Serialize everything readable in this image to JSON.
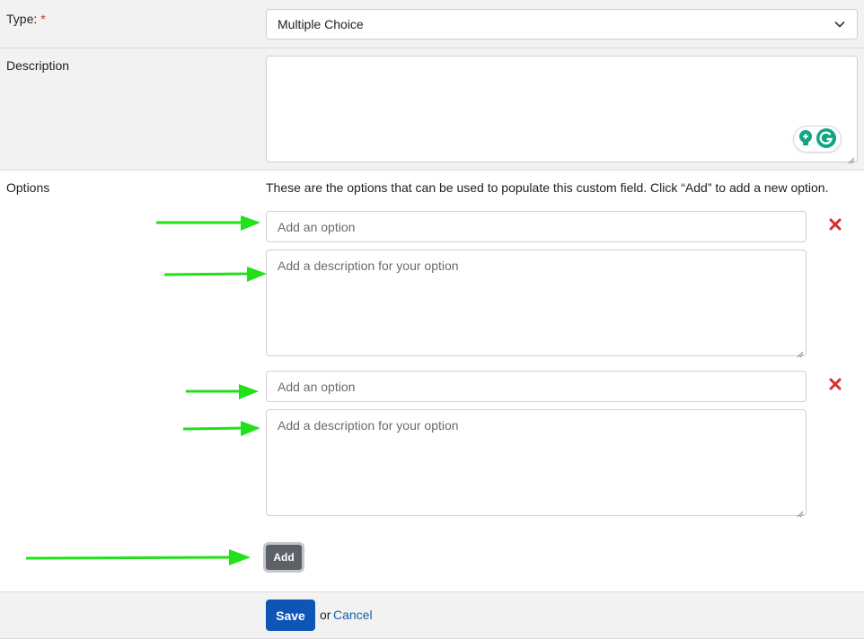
{
  "type_field": {
    "label": "Type:",
    "required_marker": "*",
    "selected_value": "Multiple Choice"
  },
  "description_field": {
    "label": "Description",
    "value": ""
  },
  "options_section": {
    "label": "Options",
    "help_text": "These are the options that can be used to populate this custom field. Click “Add” to add a new option.",
    "options": [
      {
        "name_placeholder": "Add an option",
        "description_placeholder": "Add a description for your option"
      },
      {
        "name_placeholder": "Add an option",
        "description_placeholder": "Add a description for your option"
      }
    ],
    "add_label": "Add"
  },
  "footer": {
    "save_label": "Save",
    "or_text": "or",
    "cancel_label": "Cancel"
  },
  "colors": {
    "annotation_arrow": "#22e01a",
    "remove_icon": "#d32f2f",
    "primary_button": "#0d56b8",
    "add_button": "#5c6168"
  }
}
